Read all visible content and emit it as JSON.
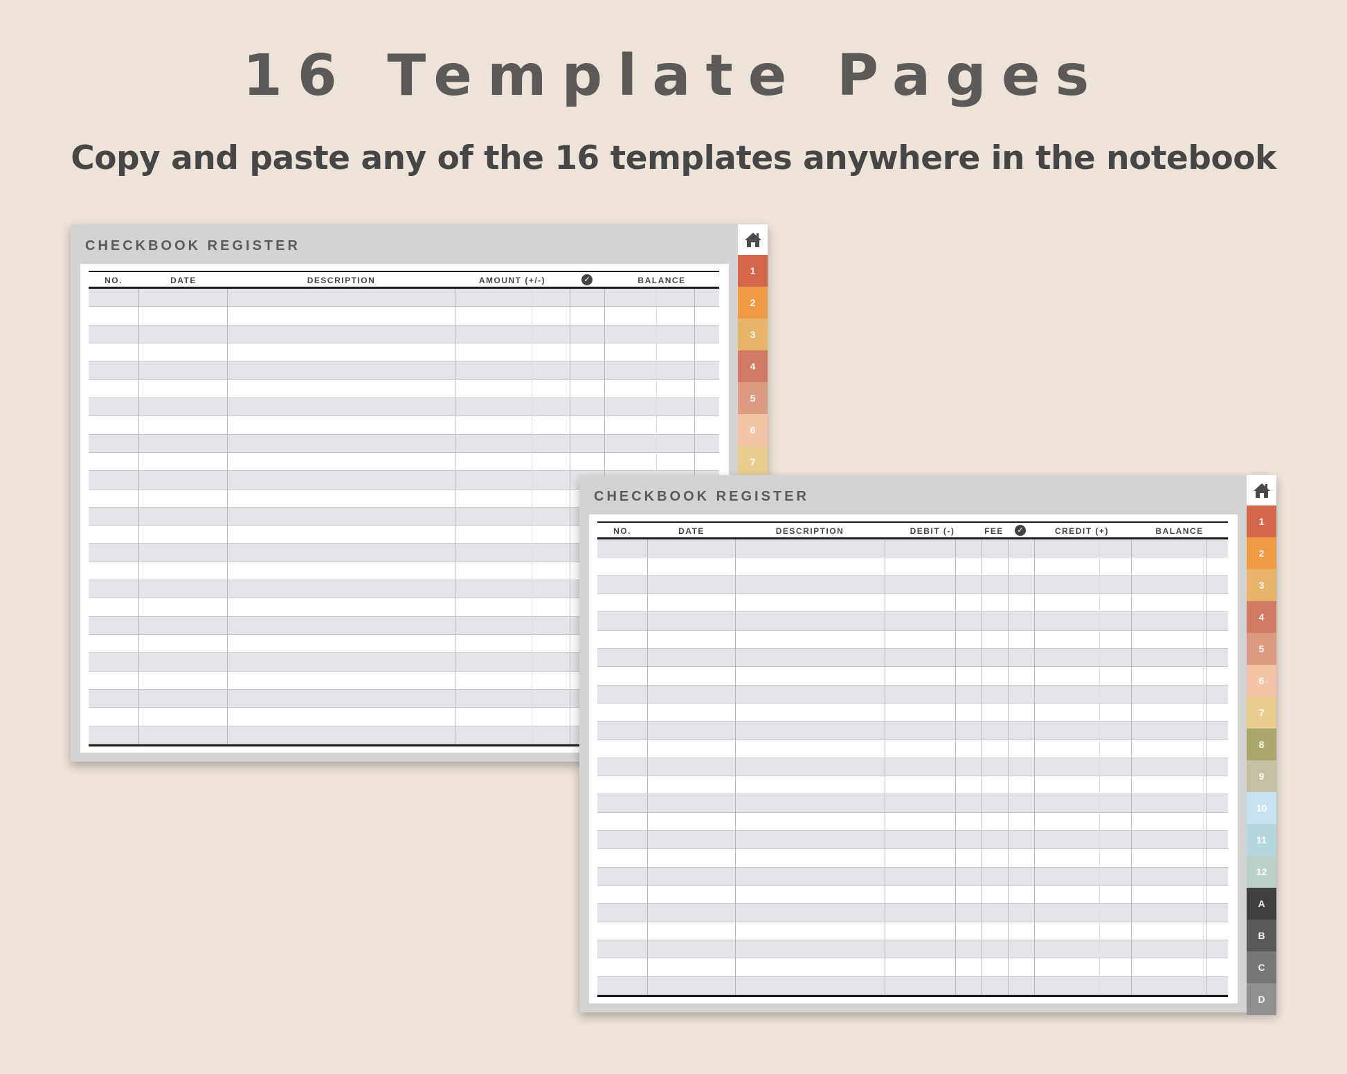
{
  "header": {
    "title": "16 Template Pages",
    "subtitle": "Copy and paste any of the 16 templates anywhere in the notebook"
  },
  "back_page": {
    "title": "CHECKBOOK REGISTER",
    "columns": [
      "NO.",
      "DATE",
      "DESCRIPTION",
      "AMOUNT (+/-)",
      "BALANCE"
    ],
    "check_column_icon": "check-circle-icon",
    "row_count": 25,
    "tabs": [
      {
        "label": "1",
        "color": "#d4664a"
      },
      {
        "label": "2",
        "color": "#ef9a45"
      },
      {
        "label": "3",
        "color": "#e8b46a"
      },
      {
        "label": "4",
        "color": "#d27b64"
      },
      {
        "label": "5",
        "color": "#dc9a83"
      },
      {
        "label": "6",
        "color": "#f5c4a6"
      },
      {
        "label": "7",
        "color": "#e8cf8f"
      }
    ]
  },
  "front_page": {
    "title": "CHECKBOOK REGISTER",
    "columns": [
      "NO.",
      "DATE",
      "DESCRIPTION",
      "DEBIT (-)",
      "FEE",
      "CREDIT (+)",
      "BALANCE"
    ],
    "check_column_icon": "check-circle-icon",
    "row_count": 25,
    "tabs": [
      {
        "label": "1",
        "color": "#d4664a"
      },
      {
        "label": "2",
        "color": "#ef9a45"
      },
      {
        "label": "3",
        "color": "#e8b46a"
      },
      {
        "label": "4",
        "color": "#d27b64"
      },
      {
        "label": "5",
        "color": "#dc9a83"
      },
      {
        "label": "6",
        "color": "#f5c4a6"
      },
      {
        "label": "7",
        "color": "#e8cf8f"
      },
      {
        "label": "8",
        "color": "#a9a76c"
      },
      {
        "label": "9",
        "color": "#c5c0a4"
      },
      {
        "label": "10",
        "color": "#c9e2ef"
      },
      {
        "label": "11",
        "color": "#b6d6de"
      },
      {
        "label": "12",
        "color": "#bcd1cb"
      },
      {
        "label": "A",
        "color": "#3f3f3f"
      },
      {
        "label": "B",
        "color": "#595959"
      },
      {
        "label": "C",
        "color": "#767676"
      },
      {
        "label": "D",
        "color": "#8f8f8f"
      }
    ]
  },
  "colors": {
    "background": "#eee3d9",
    "panel": "#d3d3d3",
    "row_shade": "#e3e4e7"
  }
}
